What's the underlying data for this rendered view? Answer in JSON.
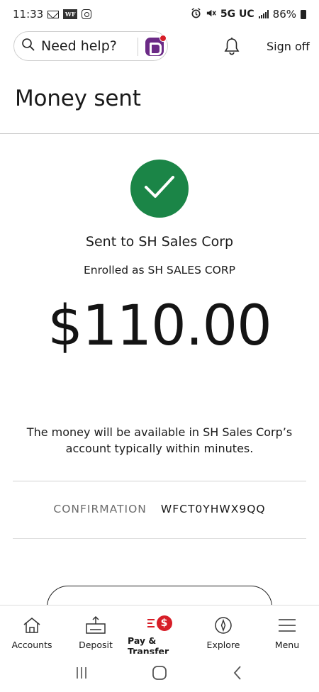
{
  "status_bar": {
    "time": "11:33",
    "network": "5G UC",
    "battery": "86%",
    "icons": [
      "mail-icon",
      "wf-app-icon",
      "instagram-icon",
      "alarm-icon",
      "mute-icon",
      "signal-icon",
      "battery-icon"
    ],
    "wf_badge": "WF"
  },
  "header": {
    "search_label": "Need help?",
    "assistant_icon": "fargo-assistant-icon",
    "notification_icon": "bell-icon",
    "sign_off": "Sign off"
  },
  "page": {
    "title": "Money sent"
  },
  "confirmation_panel": {
    "status_icon": "checkmark-icon",
    "sent_to": "Sent to SH Sales Corp",
    "enrolled_as": "Enrolled as SH SALES CORP",
    "amount": "$110.00",
    "availability_line1": "The money will be available in SH Sales Corp’s",
    "availability_line2": "account typically within minutes.",
    "confirmation_label": "CONFIRMATION",
    "confirmation_number": "WFCT0YHWX9QQ"
  },
  "bottom_nav": {
    "items": [
      {
        "label": "Accounts",
        "icon": "home-icon"
      },
      {
        "label": "Deposit",
        "icon": "deposit-icon"
      },
      {
        "label": "Pay & Transfer",
        "icon": "pay-transfer-icon",
        "active": true,
        "symbol": "$"
      },
      {
        "label": "Explore",
        "icon": "compass-icon"
      },
      {
        "label": "Menu",
        "icon": "hamburger-icon"
      }
    ]
  },
  "system_nav": {
    "icons": [
      "recent-apps-icon",
      "home-button-icon",
      "back-icon"
    ]
  },
  "colors": {
    "success_green": "#1b8547",
    "brand_red": "#d71e28",
    "fargo_purple": "#6b2a86"
  }
}
